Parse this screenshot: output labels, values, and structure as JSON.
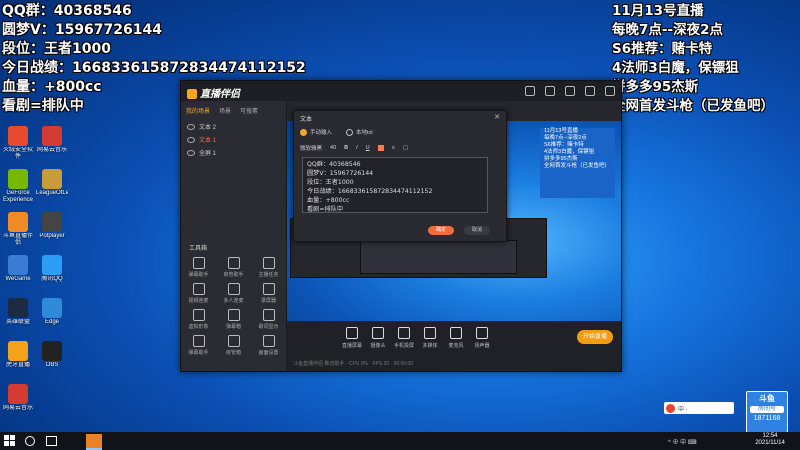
{
  "overlay_left": [
    "QQ群：40368546",
    "圆梦V：15967726144",
    "段位：王者1000",
    "今日战绩：16683361587283447411215​2",
    "血量：+800cc",
    "看剧=排队中"
  ],
  "overlay_right": [
    "11月13号直播",
    "每晚7点--深夜2点",
    "S6推荐：赌卡特",
    "4法师3白魔，保镖狙",
    "拼多多95杰斯",
    "全网首发斗枪（已发鱼吧）"
  ],
  "app": {
    "name": "直播伴侣",
    "sidebar_tabs": [
      "我的场景",
      "场景",
      "可搜素"
    ],
    "scenes": [
      "文本 2",
      "文本 1",
      "全屏 1"
    ],
    "tools_title": "工具箱",
    "tools": [
      "弹幕助手",
      "房管助手",
      "主播任务",
      "视频连麦",
      "多人连麦",
      "录屏器",
      "虚拟形象",
      "弹幕箱",
      "歌词显示",
      "弹幕助手",
      "房管箱",
      "画面设置"
    ],
    "bottom_buttons": [
      "直播屏幕",
      "摄像头",
      "手机投屏",
      "多媒体",
      "麦克风",
      "扬声器"
    ],
    "start_live": "开始直播",
    "status": "斗鱼直播伴侣 推流助手 · CPU 0% · FPS 30 · 00:00:00"
  },
  "dialog": {
    "title": "文本",
    "radio_manual": "手动输入",
    "radio_local": "本地txt",
    "font": "微软雅黑",
    "size": "40",
    "text": "QQ群：40368546\n圆梦V：15967726144\n段位：王者1000\n今日战绩：166833615872834474112152\n血量：+800cc\n看剧=排队中",
    "ok": "确定",
    "cancel": "取消"
  },
  "nested_preview_text": [
    "11月13号直播",
    "每晚7点--深夜2点",
    "S6推荐：赌卡特",
    "4法师3白魔，保镖狙",
    "拼多多95杰斯",
    "全网首发斗枪（已发鱼吧）"
  ],
  "desktop_icons": [
    {
      "label": "火绒安全软件",
      "color": "#e84a2d"
    },
    {
      "label": "网易云音乐",
      "color": "#d43c33"
    },
    {
      "label": "GeForce Experience",
      "color": "#76b900"
    },
    {
      "label": "LeagueOfLegends",
      "color": "#c89b3c"
    },
    {
      "label": "斗鱼直播伴侣",
      "color": "#f08a24"
    },
    {
      "label": "Potplayer",
      "color": "#444"
    },
    {
      "label": "WeGame",
      "color": "#3a7bd5"
    },
    {
      "label": "腾讯QQ",
      "color": "#2a9ef5"
    },
    {
      "label": "英雄联盟",
      "color": "#1e2a44"
    },
    {
      "label": "Edge",
      "color": "#2e8bd8"
    },
    {
      "label": "虎牙直播",
      "color": "#f4a21a"
    },
    {
      "label": "OBS",
      "color": "#222"
    },
    {
      "label": "网易云音乐",
      "color": "#d43c33"
    }
  ],
  "douyu_badge": {
    "name": "斗鱼",
    "room_label": "房间号",
    "room_id": "1871168"
  },
  "taskbar": {
    "tray": "^ ⊕ 中 ⌨",
    "time": "12:54",
    "date": "2021/11/14"
  },
  "ime_label": "中 ·"
}
